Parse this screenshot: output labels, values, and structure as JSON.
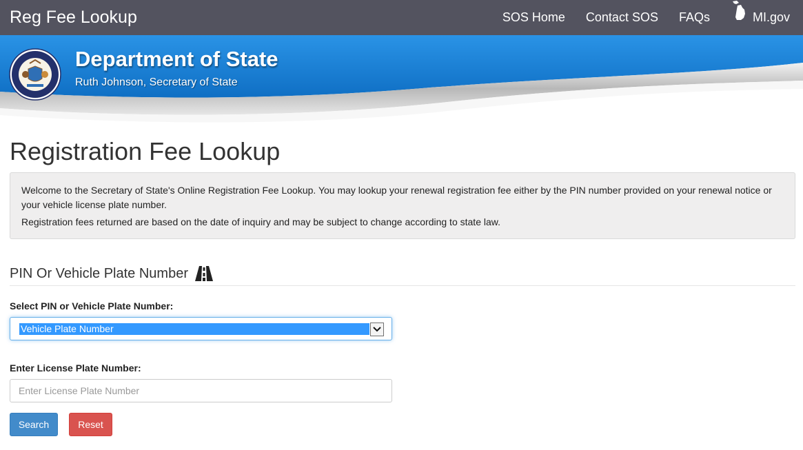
{
  "navbar": {
    "brand": "Reg Fee Lookup",
    "links": {
      "sos_home": "SOS Home",
      "contact_sos": "Contact SOS",
      "faqs": "FAQs",
      "mi_gov": "MI.gov"
    }
  },
  "banner": {
    "title": "Department of State",
    "subtitle": "Ruth Johnson, Secretary of State",
    "seal_text_top": "STATE OF MICHIGAN",
    "seal_text_bottom": "SECRETARY OF STATE"
  },
  "main": {
    "page_title": "Registration Fee Lookup",
    "info": {
      "line1": "Welcome to the Secretary of State's Online Registration Fee Lookup. You may lookup your renewal registration fee either by the PIN number provided on your renewal notice or your vehicle license plate number.",
      "line2": "Registration fees returned are based on the date of inquiry and may be subject to change according to state law."
    },
    "section_title": "PIN Or Vehicle Plate Number",
    "select": {
      "label": "Select PIN or Vehicle Plate Number:",
      "value": "Vehicle Plate Number"
    },
    "plate_input": {
      "label": "Enter License Plate Number:",
      "placeholder": "Enter License Plate Number",
      "value": ""
    },
    "buttons": {
      "search": "Search",
      "reset": "Reset"
    }
  },
  "icons": {
    "michigan": "michigan-icon",
    "road": "road-icon",
    "seal": "state-seal-icon",
    "dropdown": "chevron-down-icon"
  },
  "colors": {
    "navbar_bg": "#53535f",
    "banner_blue": "#1b7fd2",
    "select_highlight": "#3399ff",
    "search_button": "#428bca",
    "reset_button": "#d9534f"
  }
}
